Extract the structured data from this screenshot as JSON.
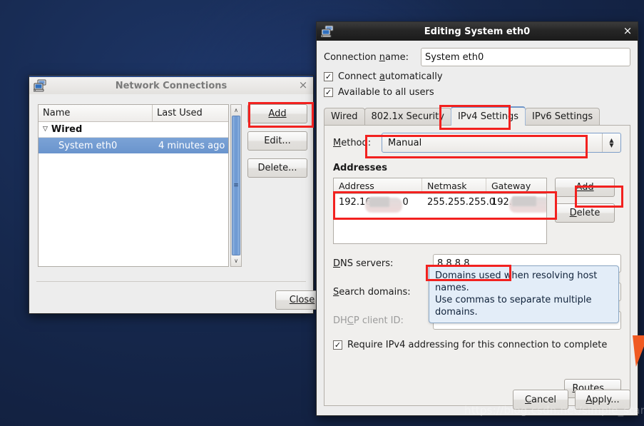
{
  "desktop": {
    "background_color": "#16284d",
    "watermark": "https://blog.csdn.net/simple_start",
    "accent_orange": "#f05a22",
    "annotation_color": "#f2211f"
  },
  "network_connections": {
    "title": "Network Connections",
    "icon": "network-computer-icon",
    "close_label": "×",
    "columns": [
      "Name",
      "Last Used"
    ],
    "groups": [
      {
        "label": "Wired",
        "expander": "▽",
        "rows": [
          {
            "name": "System eth0",
            "last_used": "4 minutes ago",
            "selected": true
          }
        ]
      }
    ],
    "buttons": {
      "add": "Add",
      "edit": "Edit...",
      "delete": "Delete...",
      "close": "Close"
    },
    "scrollbar": {
      "up": "∧",
      "down": "∨",
      "grip": "≡"
    }
  },
  "edit_dialog": {
    "title": "Editing System eth0",
    "icon": "network-computer-icon",
    "close_label": "×",
    "connection_name": {
      "label": "Connection name:",
      "value": "System eth0"
    },
    "checkboxes": [
      {
        "label": "Connect automatically",
        "checked": true,
        "mark": "✓"
      },
      {
        "label": "Available to all users",
        "checked": true,
        "mark": "✓"
      }
    ],
    "tabs": [
      {
        "label": "Wired",
        "selected": false
      },
      {
        "label": "802.1x Security",
        "selected": false
      },
      {
        "label": "IPv4 Settings",
        "selected": true
      },
      {
        "label": "IPv6 Settings",
        "selected": false
      }
    ],
    "method": {
      "label": "Method:",
      "value": "Manual",
      "arrow_up": "▲",
      "arrow_down": "▼"
    },
    "addresses": {
      "section_title": "Addresses",
      "columns": [
        "Address",
        "Netmask",
        "Gateway"
      ],
      "rows": [
        {
          "address": "192.16",
          "address_suffix": "0",
          "address_redacted": true,
          "netmask": "255.255.255.0",
          "gateway": "192.",
          "gateway_redacted": true
        }
      ],
      "buttons": {
        "add": "Add",
        "delete": "Delete"
      }
    },
    "dns_servers": {
      "label": "DNS servers:",
      "value": "8.8.8.8"
    },
    "search_domains": {
      "label": "Search domains:",
      "value": ""
    },
    "dhcp_client_id": {
      "label": "DHCP client ID:",
      "value": "",
      "disabled": true
    },
    "tooltip": {
      "line1": "Domains used when resolving host names.",
      "line2": "Use commas to separate multiple domains."
    },
    "require_ipv4": {
      "label": "Require IPv4 addressing for this connection to complete",
      "checked": true,
      "mark": "✓"
    },
    "routes_button": "Routes...",
    "actions": {
      "cancel": "Cancel",
      "apply": "Apply..."
    }
  }
}
